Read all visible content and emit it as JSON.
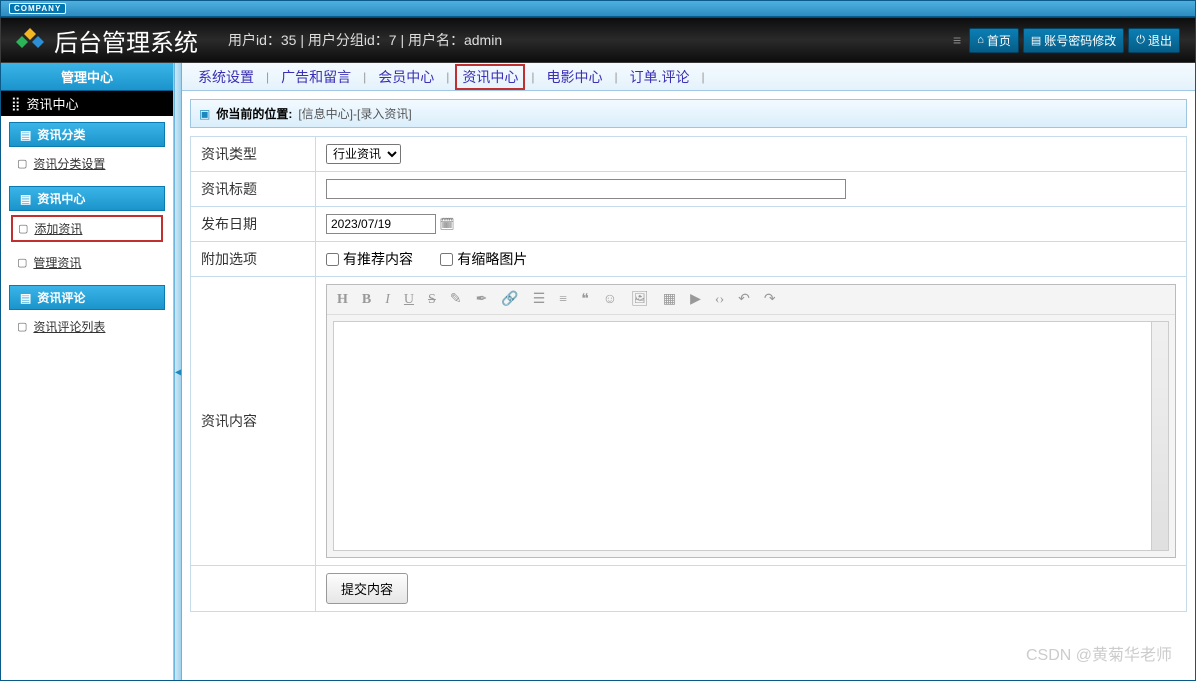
{
  "company_tag": "COMPANY",
  "app_title": "后台管理系统",
  "user_info": "用户id：35 | 用户分组id：7 | 用户名：admin",
  "header_buttons": {
    "home": "首页",
    "password": "账号密码修改",
    "logout": "退出"
  },
  "sidebar": {
    "title": "管理中心",
    "subtitle": "资讯中心",
    "groups": [
      {
        "label": "资讯分类",
        "items": [
          {
            "label": "资讯分类设置",
            "active": false
          }
        ]
      },
      {
        "label": "资讯中心",
        "items": [
          {
            "label": "添加资讯",
            "active": true
          },
          {
            "label": "管理资讯",
            "active": false
          }
        ]
      },
      {
        "label": "资讯评论",
        "items": [
          {
            "label": "资讯评论列表",
            "active": false
          }
        ]
      }
    ]
  },
  "topnav": {
    "items": [
      "系统设置",
      "广告和留言",
      "会员中心",
      "资讯中心",
      "电影中心",
      "订单.评论"
    ],
    "active_index": 3
  },
  "breadcrumb": {
    "label": "你当前的位置:",
    "path": "[信息中心]-[录入资讯]"
  },
  "form": {
    "type_label": "资讯类型",
    "type_value": "行业资讯",
    "title_label": "资讯标题",
    "title_value": "",
    "date_label": "发布日期",
    "date_value": "2023/07/19",
    "extra_label": "附加选项",
    "chk_recommend": "有推荐内容",
    "chk_thumb": "有缩略图片",
    "content_label": "资讯内容",
    "submit": "提交内容"
  },
  "editor_icons": [
    "H",
    "B",
    "I",
    "U",
    "S",
    "✎",
    "✒",
    "🔗",
    "☰",
    "≡",
    "❝",
    "☺",
    "🖼",
    "▦",
    "▶",
    "‹›",
    "↶",
    "↷"
  ],
  "watermark": "CSDN @黄菊华老师"
}
